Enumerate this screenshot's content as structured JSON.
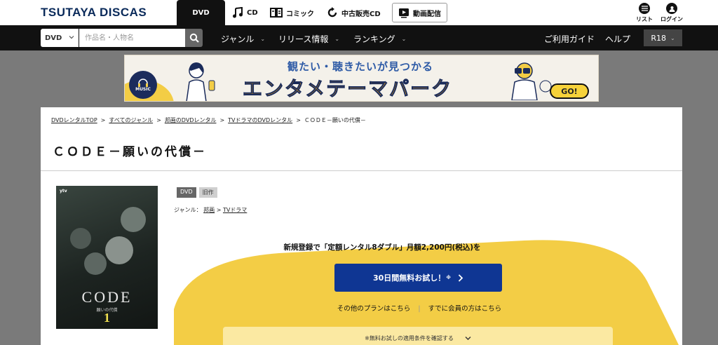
{
  "header": {
    "logo": "TSUTAYA DISCAS",
    "tabs": [
      {
        "label": "DVD",
        "icon": "none"
      },
      {
        "label": "CD",
        "icon": "music-note-icon"
      },
      {
        "label": "コミック",
        "icon": "book-icon"
      },
      {
        "label": "中古販売CD",
        "icon": "recycle-icon"
      },
      {
        "label": "動画配信",
        "icon": "play-tv-icon"
      }
    ],
    "list_label": "リスト",
    "login_label": "ログイン"
  },
  "nav": {
    "search_category": "DVD",
    "search_placeholder": "作品名・人物名",
    "items": [
      "ジャンル",
      "リリース情報",
      "ランキング"
    ],
    "guide": "ご利用ガイド",
    "help": "ヘルプ",
    "r18": "R18"
  },
  "banner": {
    "subtitle": "観たい・聴きたいが見つかる",
    "title": "エンタメテーマパーク",
    "go": "GO!",
    "music_badge": "MUSIC"
  },
  "breadcrumb": [
    "DVDレンタルTOP",
    "すべてのジャンル",
    "邦画のDVDレンタル",
    "TVドラマのDVDレンタル",
    "ＣＯＤＥ－願いの代償－"
  ],
  "page_title": "ＣＯＤＥ－願いの代償－",
  "cover": {
    "network": "ytv",
    "title": "CODE",
    "subtitle": "願いの代償",
    "volume": "1"
  },
  "badges": {
    "format": "DVD",
    "status": "旧作"
  },
  "genre": {
    "label": "ジャンル：",
    "items": [
      "邦画",
      "TVドラマ"
    ],
    "sep": ">"
  },
  "promo": {
    "text": "新規登録で「定額レンタル8ダブル」月額2,200円(税込)を",
    "button": "30日間無料お試し！",
    "button_note": "※",
    "link_other": "その他のプランはこちら",
    "link_member": "すでに会員の方はこちら",
    "conditions": "※無料お試しの適用条件を確認する"
  },
  "colors": {
    "accent_blue": "#0f3693",
    "promo_yellow": "#f3cd45",
    "banner_orange": "#e8a21a"
  }
}
